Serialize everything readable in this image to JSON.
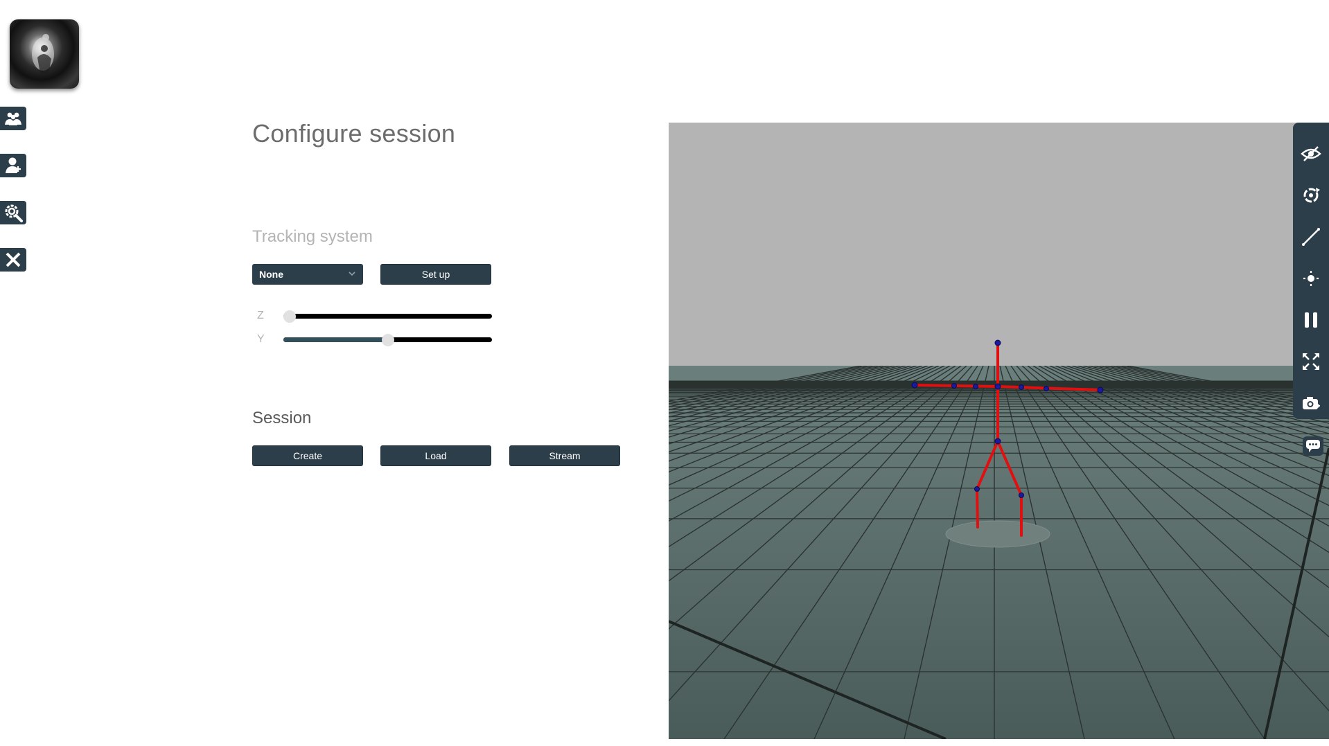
{
  "page": {
    "title": "Configure session"
  },
  "tracking": {
    "title": "Tracking system",
    "title_color": "#b4b4b4",
    "select_value": "None",
    "setup_label": "Set up",
    "z_label": "Z",
    "y_label": "Y",
    "z_value": 0.03,
    "y_value": 0.5
  },
  "session": {
    "title": "Session",
    "title_color": "#5a5a5a",
    "create_label": "Create",
    "load_label": "Load",
    "stream_label": "Stream"
  },
  "sidebar": {
    "items": [
      {
        "icon": "group-icon"
      },
      {
        "icon": "add-user-icon"
      },
      {
        "icon": "search-settings-icon"
      },
      {
        "icon": "close-icon"
      }
    ]
  },
  "toolbar": {
    "items": [
      {
        "icon": "hide-eye-icon"
      },
      {
        "icon": "rotate-target-icon"
      },
      {
        "icon": "line-measure-icon"
      },
      {
        "icon": "light-sun-icon"
      },
      {
        "icon": "pause-icon"
      },
      {
        "icon": "fullscreen-expand-icon"
      },
      {
        "icon": "screenshot-camera-icon"
      }
    ],
    "chat_icon": "chat-icon"
  },
  "colors": {
    "accent": "#2c3e4a",
    "sky": "#b4b4b4",
    "floor": "#5a706d",
    "skeleton": "#e01010",
    "joints": "#1a1a9a"
  }
}
